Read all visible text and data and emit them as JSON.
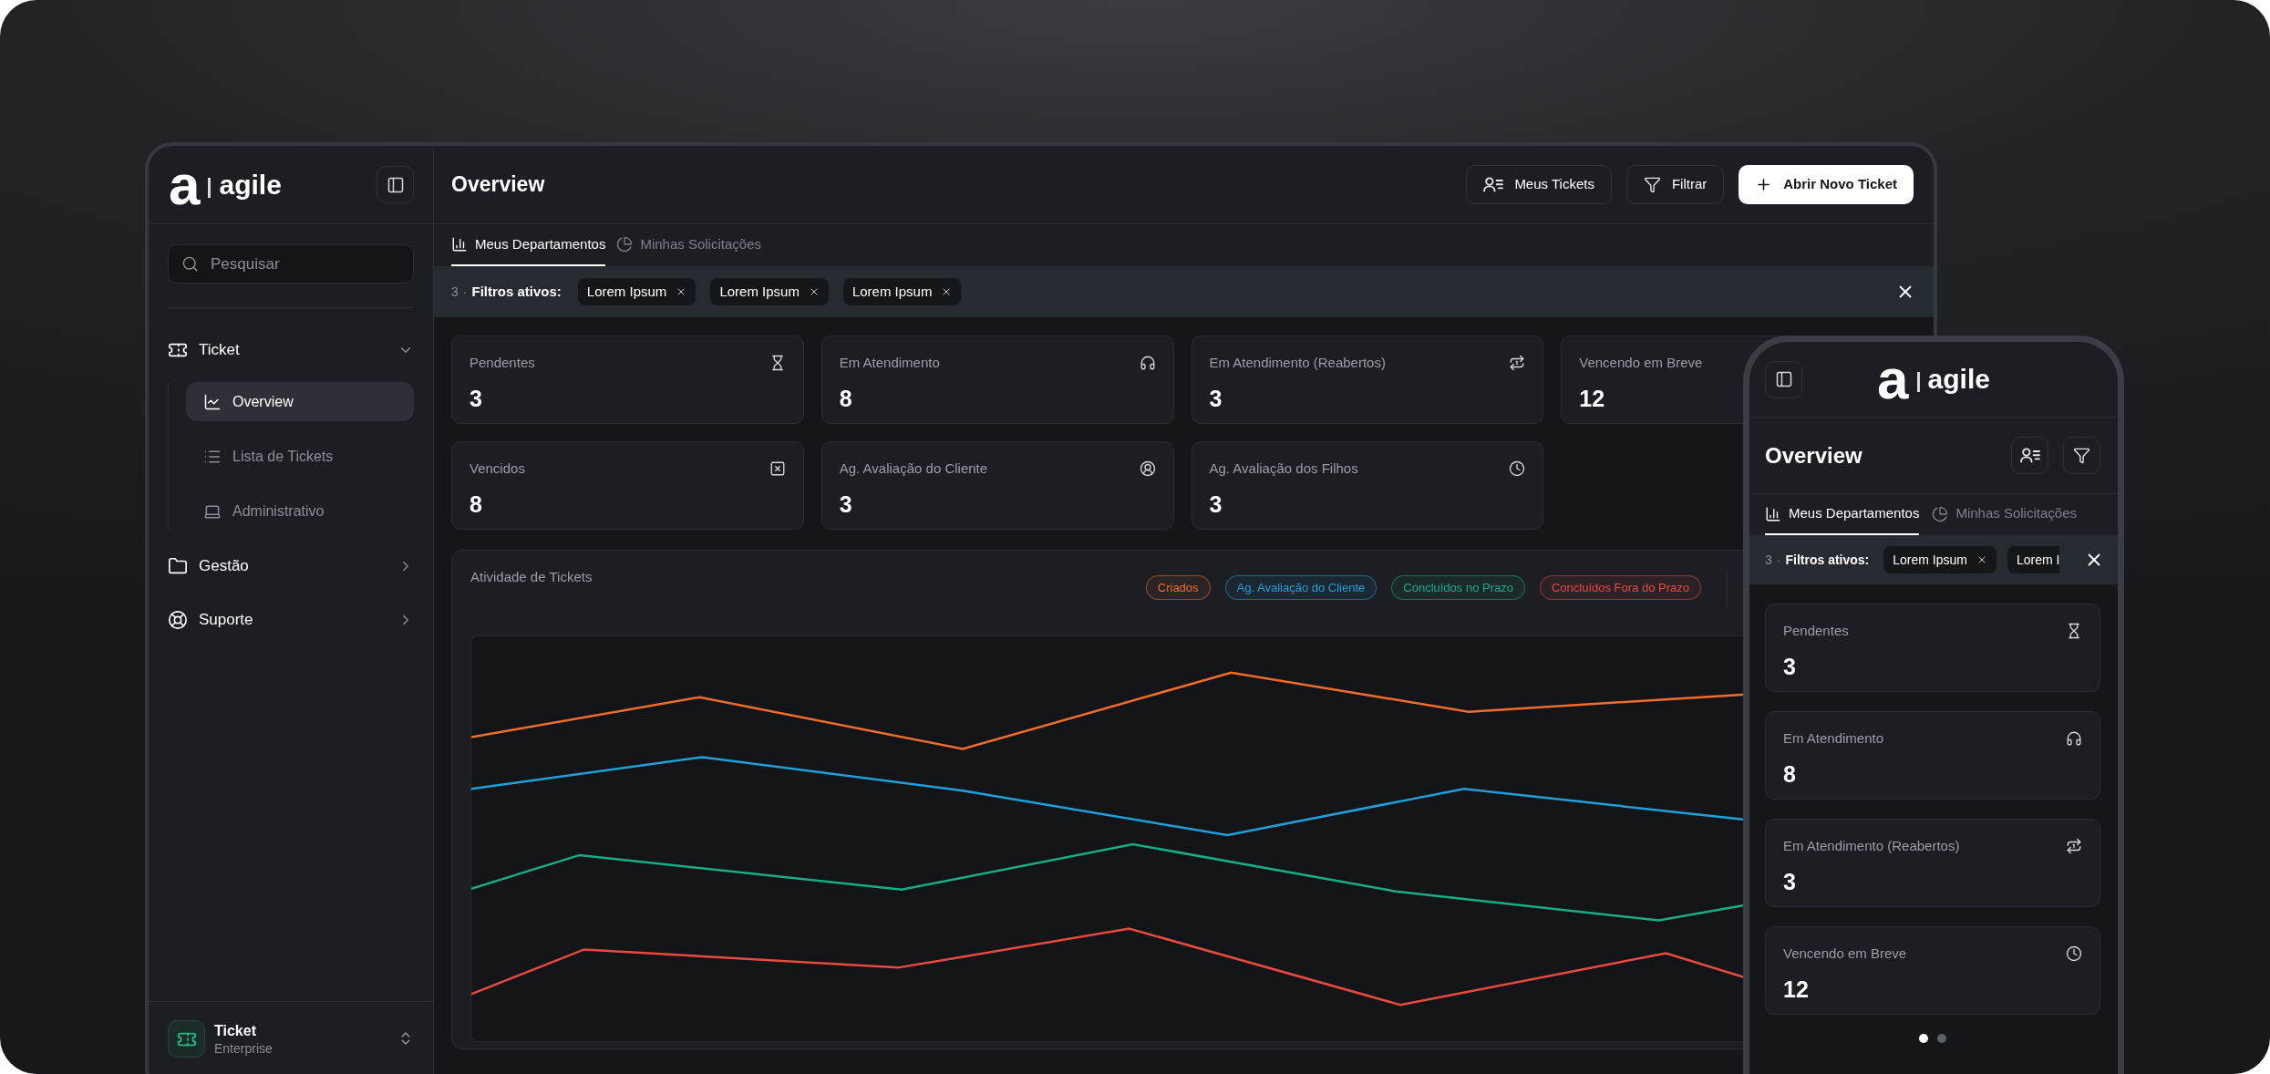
{
  "logo": {
    "mark": "a",
    "name": "agile"
  },
  "sidebar": {
    "search": {
      "placeholder": "Pesquisar"
    },
    "nav": [
      {
        "label": "Ticket",
        "expanded": true,
        "children": [
          {
            "label": "Overview",
            "selected": true
          },
          {
            "label": "Lista de Tickets",
            "selected": false
          },
          {
            "label": "Administrativo",
            "selected": false
          }
        ]
      },
      {
        "label": "Gestão",
        "expanded": false
      },
      {
        "label": "Suporte",
        "expanded": false
      }
    ],
    "workspace": {
      "name": "Ticket",
      "plan": "Enterprise"
    }
  },
  "header": {
    "title": "Overview",
    "buttons": [
      {
        "kind": "list",
        "label": "Meus Tickets"
      },
      {
        "kind": "filter",
        "label": "Filtrar"
      },
      {
        "kind": "primary",
        "label": "Abrir Novo Ticket"
      }
    ]
  },
  "tabs": [
    {
      "label": "Meus Departamentos",
      "selected": true
    },
    {
      "label": "Minhas Solicitações",
      "selected": false
    }
  ],
  "filter_bar": {
    "count": "3",
    "separator": "·",
    "label": "Filtros ativos:",
    "chips": [
      {
        "label": "Lorem Ipsum",
        "cut": false
      },
      {
        "label": "Lorem Ipsum",
        "cut": false
      },
      {
        "label": "Lorem Ipsum",
        "cut": false
      }
    ]
  },
  "stats": [
    {
      "label": "Pendentes",
      "value": "3"
    },
    {
      "label": "Em Atendimento",
      "value": "8"
    },
    {
      "label": "Em Atendimento (Reabertos)",
      "value": "3"
    },
    {
      "label": "Vencendo em Breve",
      "value": "12"
    },
    {
      "label": "Vencidos",
      "value": "8"
    },
    {
      "label": "Ag. Avaliação do Cliente",
      "value": "3"
    },
    {
      "label": "Ag. Avaliação dos Filhos",
      "value": "3"
    }
  ],
  "activity": {
    "title": "Atividade de Tickets",
    "legend": [
      {
        "label": "Criados",
        "color": "#f06d2c"
      },
      {
        "label": "Ag. Avaliação do Cliente",
        "color": "#1fa0da"
      },
      {
        "label": "Concluídos no Prazo",
        "color": "#19ad85"
      },
      {
        "label": "Concluídos Fora do Prazo",
        "color": "#ea4a3e"
      }
    ]
  },
  "phone": {
    "logo": {
      "mark": "a",
      "name": "agile"
    },
    "title": "Overview",
    "buttons": [
      {
        "kind": "list"
      },
      {
        "kind": "filter"
      }
    ],
    "tabs": [
      {
        "label": "Meus Departamentos",
        "selected": true
      },
      {
        "label": "Minhas Solicitações",
        "selected": false
      }
    ],
    "filter_bar": {
      "count": "3",
      "separator": "·",
      "label": "Filtros ativos:",
      "chips": [
        {
          "label": "Lorem Ipsum",
          "cut": false
        },
        {
          "label": "Lorem I",
          "cut": true
        }
      ]
    },
    "stats": [
      {
        "label": "Pendentes",
        "value": "3"
      },
      {
        "label": "Em Atendimento",
        "value": "8"
      },
      {
        "label": "Em Atendimento (Reabertos)",
        "value": "3"
      },
      {
        "label": "Vencendo em Breve",
        "value": "12"
      }
    ],
    "pages": [
      {
        "selected": true
      },
      {
        "selected": false
      }
    ]
  }
}
